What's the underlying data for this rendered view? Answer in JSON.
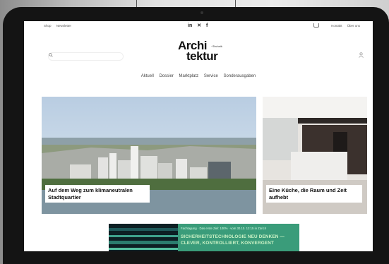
{
  "topbar": {
    "left_links": [
      "Shop",
      "Newsletter"
    ],
    "social": [
      "in",
      "✕",
      "f"
    ],
    "right_links": [
      "Kontakt",
      "Über uns"
    ]
  },
  "logo": {
    "line1": "Archi",
    "line2": "tektur",
    "suffix": "+Technik"
  },
  "nav": {
    "items": [
      "Aktuell",
      "Dossier",
      "Marktplatz",
      "Service",
      "Sonderausgaben"
    ]
  },
  "articles": [
    {
      "headline": "Auf dem Weg zum klimaneutralen Stadtquartier"
    },
    {
      "headline": "Eine Küche, die Raum und Zeit aufhebt"
    }
  ],
  "banner": {
    "small_text": "Fachtagung · Das erste Ziel: 100% · vom 30.10. 13:15 in Zürich",
    "headline": "SICHERHEITSTECHNOLOGIE NEU DENKEN — CLEVER, KONTROLLIERT, KONVERGENT"
  },
  "colors": {
    "banner_green": "#3a9c7a",
    "tablet_frame": "#141414",
    "page_bg": "#ffffff"
  }
}
